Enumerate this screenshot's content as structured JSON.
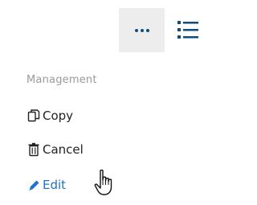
{
  "toolbar": {
    "more_icon": "ellipsis-icon",
    "list_icon": "list-icon",
    "accent_color": "#0d4e82",
    "more_button_bg": "#ededed"
  },
  "menu": {
    "heading": "Management",
    "items": [
      {
        "label": "Copy",
        "icon": "copy-icon"
      },
      {
        "label": "Cancel",
        "icon": "trash-icon"
      },
      {
        "label": "Edit",
        "icon": "pencil-icon",
        "color": "#1f74c9"
      }
    ]
  },
  "cursor": {
    "icon": "hand-pointer-icon"
  }
}
